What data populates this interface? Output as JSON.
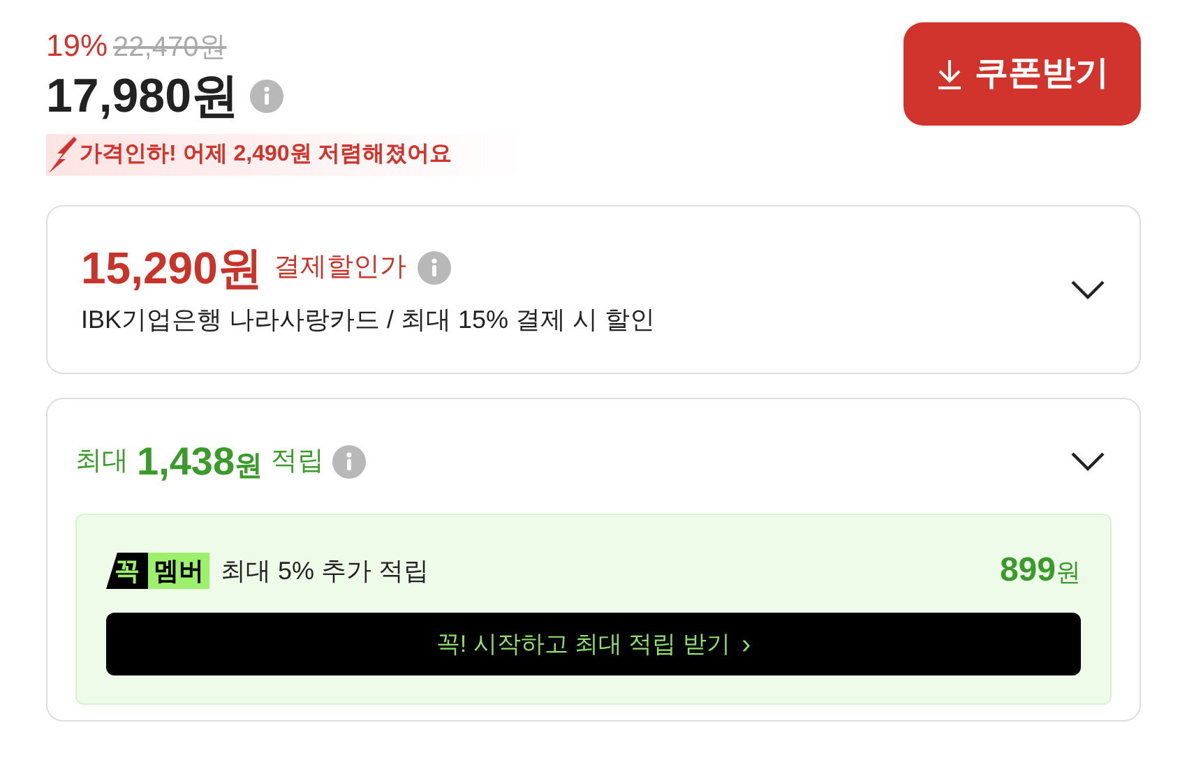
{
  "price": {
    "discount_rate": "19%",
    "original_price": "22,470원",
    "sale_price": "17,980원"
  },
  "price_drop": {
    "text": "가격인하! 어제 **2,490**원 저렴해졌어요"
  },
  "coupon_button": {
    "label": "쿠폰받기"
  },
  "card_discount": {
    "amount": "15,290원",
    "label": "결제할인가",
    "description": "IBK기업은행 나라사랑카드 / 최대 15% 결제 시 할인"
  },
  "points": {
    "prefix": "최대",
    "amount": "1,438",
    "unit": "원",
    "suffix": "적립",
    "membership": {
      "badge_left": "꼭",
      "badge_right": "멤버",
      "text": "최대 5% 추가 적립",
      "amount": "899",
      "unit": "원",
      "button": "꼭! 시작하고 최대 적립 받기",
      "button_arrow": "›"
    }
  }
}
